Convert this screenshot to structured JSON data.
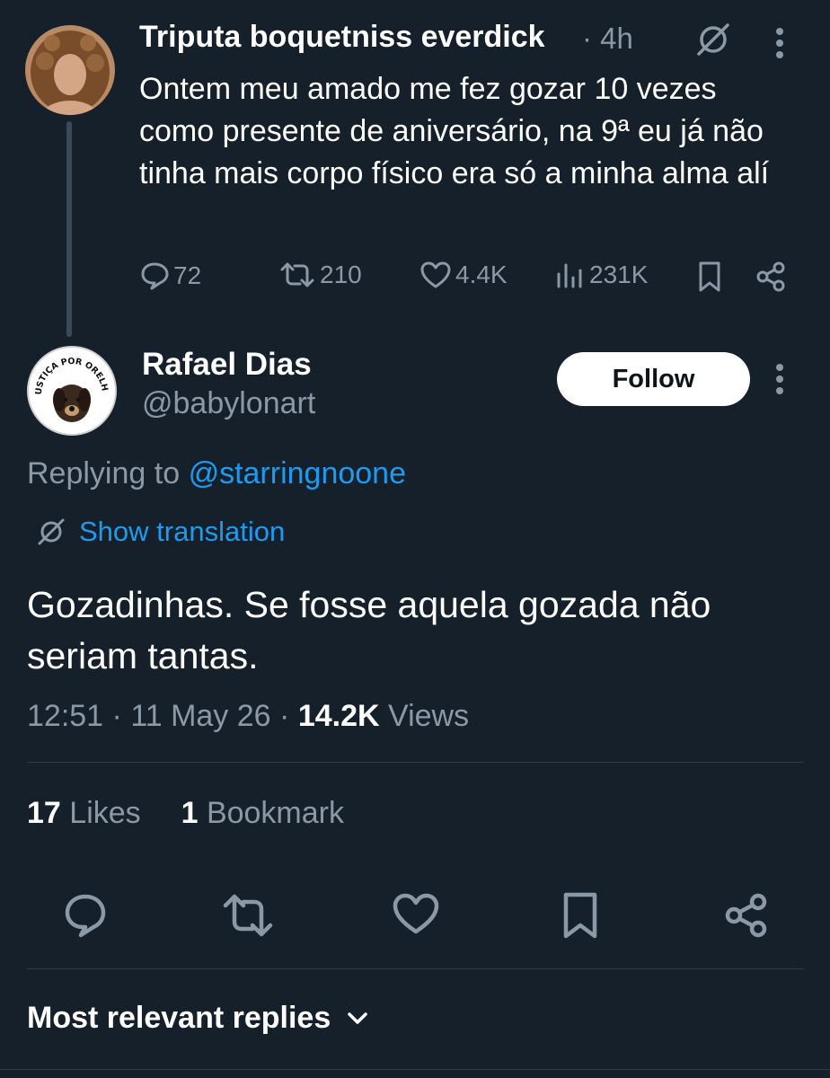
{
  "parent_tweet": {
    "display_name": "Triputa boquetniss everdick",
    "time": "· 4h",
    "text": "Ontem meu amado me fez gozar 10 vezes como presente de aniversário, na 9ª eu já não tinha mais corpo físico era só a minha alma alí",
    "stats": {
      "replies": "72",
      "reposts": "210",
      "likes": "4.4K",
      "views": "231K"
    }
  },
  "reply_tweet": {
    "display_name": "Rafael Dias",
    "handle": "@babylonart",
    "avatar_badge_text": "JUSTIÇA POR ORELHA",
    "follow_label": "Follow",
    "replying_prefix": "Replying to",
    "replying_handle": "@starringnoone",
    "show_translation": "Show translation",
    "text": "Gozadinhas. Se fosse aquela gozada não seriam tantas.",
    "time": "12:51",
    "date": "11 May 26",
    "views_count": "14.2K",
    "views_label": "Views",
    "likes_count": "17",
    "likes_label": "Likes",
    "bookmarks_count": "1",
    "bookmarks_label": "Bookmark"
  },
  "replies_sort": {
    "label": "Most relevant replies"
  },
  "colors": {
    "background": "#15202b",
    "accent": "#1d9bf0",
    "muted": "#8b98a5"
  }
}
